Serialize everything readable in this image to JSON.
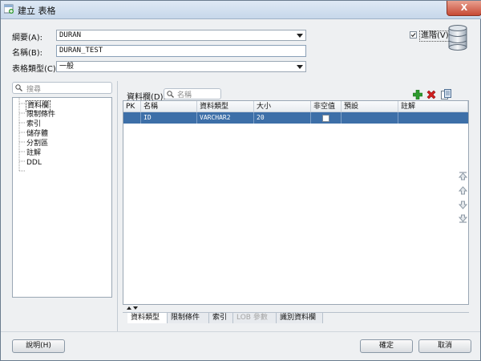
{
  "window": {
    "title": "建立 表格",
    "close_glyph": "X"
  },
  "form": {
    "schema_label": "綱要(A):",
    "schema_value": "DURAN",
    "name_label": "名稱(B):",
    "name_value": "DURAN_TEST",
    "table_type_label": "表格類型(C):",
    "table_type_value": "一般",
    "advanced_label": "進階(V)"
  },
  "left_search": {
    "placeholder": "搜尋"
  },
  "sidebar": {
    "items": [
      {
        "label": "資料欄"
      },
      {
        "label": "限制條件"
      },
      {
        "label": "索引"
      },
      {
        "label": "儲存體"
      },
      {
        "label": "分割區"
      },
      {
        "label": "註解"
      },
      {
        "label": "DDL"
      }
    ]
  },
  "columns_panel": {
    "label": "資料欄(D):",
    "search_placeholder": "名稱",
    "headers": [
      "PK",
      "名稱",
      "資料類型",
      "大小",
      "非空值",
      "預設",
      "註解"
    ],
    "rows": [
      {
        "pk": "",
        "name": "ID",
        "type": "VARCHAR2",
        "size": "20",
        "not_null": "",
        "default": "",
        "comment": ""
      }
    ]
  },
  "tabs": [
    {
      "label": "資料類型"
    },
    {
      "label": "限制條件"
    },
    {
      "label": "索引"
    },
    {
      "label": "LOB 參數"
    },
    {
      "label": "識別資料欄"
    }
  ],
  "buttons": {
    "help": "說明(H)",
    "ok": "確定",
    "cancel": "取消"
  },
  "colors": {
    "selection": "#3d6fa8",
    "add": "#2e9a2e",
    "delete": "#d22020"
  }
}
